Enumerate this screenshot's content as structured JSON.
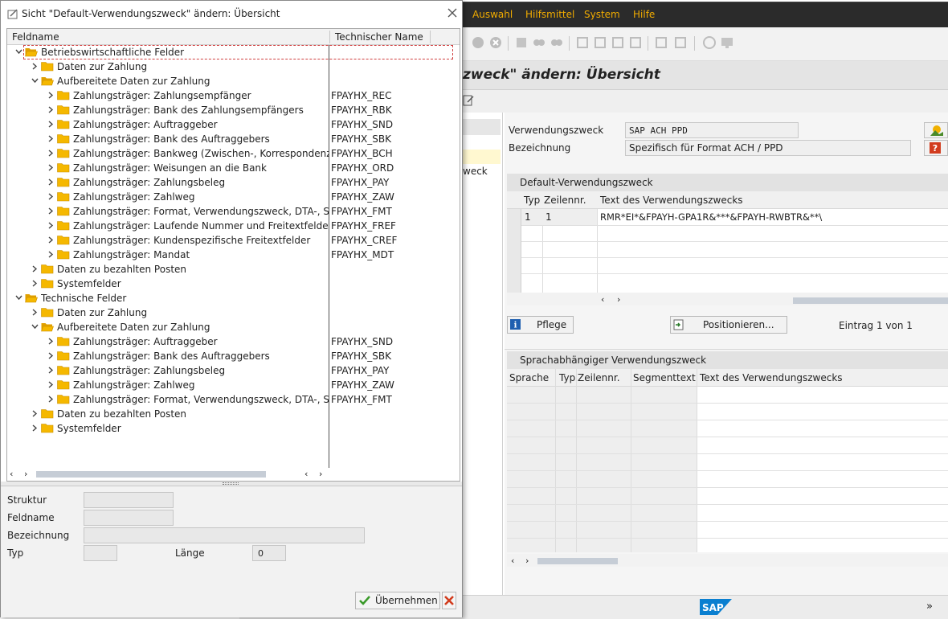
{
  "background_window": {
    "menu": [
      "Auswahl",
      "Hilfsmittel",
      "System",
      "Hilfe"
    ],
    "title_fragment": "zweck\" ändern: Übersicht",
    "left_fragment": "weck",
    "fields": {
      "verwendungszweck_label": "Verwendungszweck",
      "verwendungszweck_value": "SAP ACH PPD",
      "bezeichnung_label": "Bezeichnung",
      "bezeichnung_value": "Spezifisch für Format ACH / PPD"
    },
    "default_group": {
      "title": "Default-Verwendungszweck",
      "columns": [
        "Typ",
        "Zeilennr.",
        "Text des Verwendungszwecks"
      ],
      "rows": [
        {
          "typ": "1",
          "zeile": "1",
          "text": "RMR*EI*&FPAYH-GPA1R&***&FPAYH-RWBTR&**\\"
        }
      ],
      "pflege_button": "Pflege",
      "positionieren_button": "Positionieren...",
      "entry_count": "Eintrag 1 von 1"
    },
    "language_group": {
      "title": "Sprachabhängiger Verwendungszweck",
      "columns": [
        "Sprache",
        "Typ",
        "Zeilennr.",
        "Segmenttext",
        "Text des Verwendungszwecks"
      ]
    },
    "status_chevron": "»"
  },
  "dialog": {
    "title": "Sicht \"Default-Verwendungszweck\" ändern: Übersicht",
    "tree_headers": [
      "Feldname",
      "Technischer Name"
    ],
    "tree_rows": [
      {
        "level": 0,
        "label": "Betriebswirtschaftliche Felder",
        "tech": "",
        "expanded": true
      },
      {
        "level": 1,
        "label": "Daten zur Zahlung",
        "tech": "",
        "expanded": false
      },
      {
        "level": 1,
        "label": "Aufbereitete Daten zur Zahlung",
        "tech": "",
        "expanded": true
      },
      {
        "level": 2,
        "label": "Zahlungsträger: Zahlungsempfänger",
        "tech": "FPAYHX_REC",
        "expanded": false
      },
      {
        "level": 2,
        "label": "Zahlungsträger: Bank des Zahlungsempfängers",
        "tech": "FPAYHX_RBK",
        "expanded": false
      },
      {
        "level": 2,
        "label": "Zahlungsträger: Auftraggeber",
        "tech": "FPAYHX_SND",
        "expanded": false
      },
      {
        "level": 2,
        "label": "Zahlungsträger: Bank des Auftraggebers",
        "tech": "FPAYHX_SBK",
        "expanded": false
      },
      {
        "level": 2,
        "label": "Zahlungsträger: Bankweg (Zwischen-, Korrespondenzbank",
        "tech": "FPAYHX_BCH",
        "expanded": false
      },
      {
        "level": 2,
        "label": "Zahlungsträger: Weisungen an die Bank",
        "tech": "FPAYHX_ORD",
        "expanded": false
      },
      {
        "level": 2,
        "label": "Zahlungsträger: Zahlungsbeleg",
        "tech": "FPAYHX_PAY",
        "expanded": false
      },
      {
        "level": 2,
        "label": "Zahlungsträger: Zahlweg",
        "tech": "FPAYHX_ZAW",
        "expanded": false
      },
      {
        "level": 2,
        "label": "Zahlungsträger: Format, Verwendungszweck, DTA-, Sche",
        "tech": "FPAYHX_FMT",
        "expanded": false
      },
      {
        "level": 2,
        "label": "Zahlungsträger: Laufende Nummer und Freitextfelder",
        "tech": "FPAYHX_FREF",
        "expanded": false
      },
      {
        "level": 2,
        "label": "Zahlungsträger: Kundenspezifische Freitextfelder",
        "tech": "FPAYHX_CREF",
        "expanded": false
      },
      {
        "level": 2,
        "label": "Zahlungsträger: Mandat",
        "tech": "FPAYHX_MDT",
        "expanded": false
      },
      {
        "level": 1,
        "label": "Daten zu bezahlten Posten",
        "tech": "",
        "expanded": false
      },
      {
        "level": 1,
        "label": "Systemfelder",
        "tech": "",
        "expanded": false
      },
      {
        "level": 0,
        "label": "Technische Felder",
        "tech": "",
        "expanded": true
      },
      {
        "level": 1,
        "label": "Daten zur Zahlung",
        "tech": "",
        "expanded": false
      },
      {
        "level": 1,
        "label": "Aufbereitete Daten zur Zahlung",
        "tech": "",
        "expanded": true
      },
      {
        "level": 2,
        "label": "Zahlungsträger: Auftraggeber",
        "tech": "FPAYHX_SND",
        "expanded": false
      },
      {
        "level": 2,
        "label": "Zahlungsträger: Bank des Auftraggebers",
        "tech": "FPAYHX_SBK",
        "expanded": false
      },
      {
        "level": 2,
        "label": "Zahlungsträger: Zahlungsbeleg",
        "tech": "FPAYHX_PAY",
        "expanded": false
      },
      {
        "level": 2,
        "label": "Zahlungsträger: Zahlweg",
        "tech": "FPAYHX_ZAW",
        "expanded": false
      },
      {
        "level": 2,
        "label": "Zahlungsträger: Format, Verwendungszweck, DTA-, Sche",
        "tech": "FPAYHX_FMT",
        "expanded": false
      },
      {
        "level": 1,
        "label": "Daten zu bezahlten Posten",
        "tech": "",
        "expanded": false
      },
      {
        "level": 1,
        "label": "Systemfelder",
        "tech": "",
        "expanded": false
      }
    ],
    "detail": {
      "struktur_label": "Struktur",
      "feldname_label": "Feldname",
      "bezeichnung_label": "Bezeichnung",
      "typ_label": "Typ",
      "laenge_label": "Länge",
      "laenge_value": "0"
    },
    "uebernehmen_button": "Übernehmen"
  },
  "colors": {
    "menubar_bg": "#2b2b2b",
    "menu_text": "#f0ab00",
    "folder": "#f5b800",
    "selection_border": "#d04040",
    "accept_green": "#3a9a2a",
    "cancel_red": "#d23c1e"
  }
}
